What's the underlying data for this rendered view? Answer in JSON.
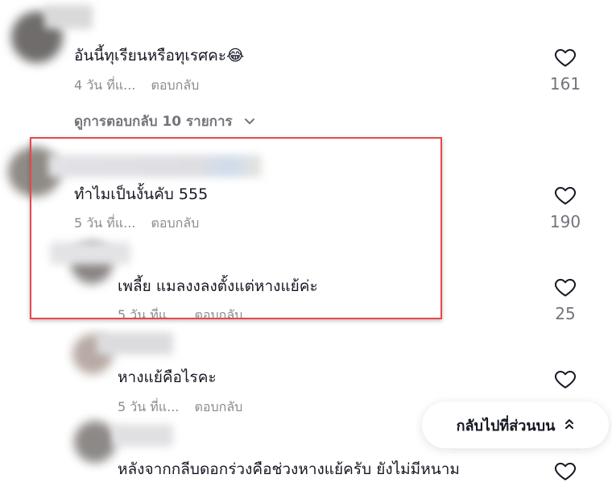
{
  "comments": [
    {
      "text": "อันนี้ทุเรียนหรือทุเรศคะ😂",
      "time": "4 วัน ที่แ...",
      "reply_label": "ตอบกลับ",
      "likes": "161"
    },
    {
      "text": "ทำไมเป็นงั้นคับ 555",
      "time": "5 วัน ที่แ...",
      "reply_label": "ตอบกลับ",
      "likes": "190"
    },
    {
      "text": "เพลี้ย แมลงงลงตั้งแต่หางแย้ค่ะ",
      "time": "5 วัน ที่แ...",
      "reply_label": "ตอบกลับ",
      "likes": "25"
    },
    {
      "text": "หางแย้คือไรคะ",
      "time": "5 วัน ที่แ...",
      "reply_label": "ตอบกลับ",
      "likes": ""
    },
    {
      "text": "หลังจากกลีบดอกร่วงคือช่วงหางแย้ครับ ยังไม่มีหนาม",
      "time": "",
      "reply_label": "",
      "likes": ""
    }
  ],
  "view_replies_label": "ดูการตอบกลับ 10 รายการ",
  "back_to_top_label": "กลับไปที่ส่วนบน",
  "colors": {
    "highlight_border": "#e8484b",
    "meta_text": "#8a8b91",
    "primary_text": "#161823"
  },
  "icons": {
    "like": "heart-outline-icon",
    "expand": "chevron-down-icon",
    "back_to_top": "double-chevron-up-icon"
  }
}
